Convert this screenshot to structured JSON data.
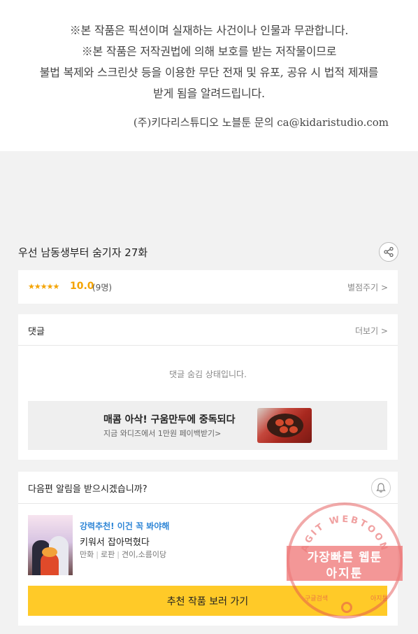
{
  "notice": {
    "line1": "※본 작품은 픽션이며 실재하는 사건이나 인물과 무관합니다.",
    "line2": "※본 작품은 저작권법에 의해 보호를 받는 저작물이므로",
    "line3": "불법 복제와 스크린샷 등을 이용한 무단 전재 및 유포, 공유 시 법적 제재를",
    "line4": "받게 됨을 알려드립니다.",
    "contact": "(주)키다리스튜디오 노블툰 문의 ca@kidaristudio.com"
  },
  "episode": {
    "title": "우선 남동생부터 숨기자 27화",
    "share_icon": "share-icon"
  },
  "rating": {
    "stars": "★★★★★",
    "score": "10.0",
    "votes": "(9명)",
    "rate_link": "별점주기 >"
  },
  "comments": {
    "title": "댓글",
    "more": "더보기 >",
    "hidden_message": "댓글 숨김 상태입니다.",
    "banner_title": "매콤 아삭! 구움만두에 중독되다",
    "banner_sub": "지금 와디즈에서 1만원 페이백받기>"
  },
  "notify": {
    "title": "다음편 알림을 받으시겠습니까?",
    "bell_icon": "bell-icon",
    "rec_label": "강력추천! 이건 꼭 봐야해",
    "rec_title": "키워서 잡아먹혔다",
    "genre": "만화",
    "category": "로판",
    "authors": "견이,소름이당",
    "button": "추천 작품 보러 가기"
  },
  "stamp": {
    "ring": "AGIT WEBTOON",
    "line1": "가장빠른 웹툰",
    "line2": "아지툰",
    "bottom_left": "구글검색",
    "bottom_right": "아지툰"
  },
  "colors": {
    "accent": "#f4a300",
    "button": "#ffca28",
    "link_blue": "#2f86d6",
    "stamp": "#e25050"
  }
}
